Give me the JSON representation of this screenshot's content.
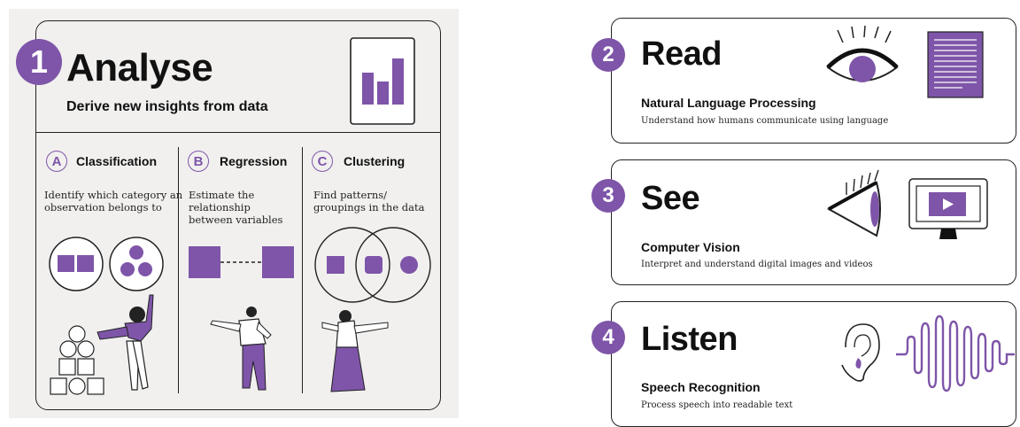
{
  "analyse": {
    "number": "1",
    "title": "Analyse",
    "subtitle": "Derive new insights from data",
    "columns": [
      {
        "letter": "A",
        "title": "Classification",
        "desc_lines": [
          "Identify which category an",
          "observation belongs to"
        ]
      },
      {
        "letter": "B",
        "title": "Regression",
        "desc_lines": [
          "Estimate the",
          "relationship",
          "between variables"
        ]
      },
      {
        "letter": "C",
        "title": "Clustering",
        "desc_lines": [
          "Find patterns/",
          "groupings in the data"
        ]
      }
    ]
  },
  "cards": [
    {
      "number": "2",
      "title": "Read",
      "subtitle": "Natural Language Processing",
      "desc": "Understand how humans communicate using language",
      "icons": [
        "eye-icon",
        "document-icon"
      ]
    },
    {
      "number": "3",
      "title": "See",
      "subtitle": "Computer Vision",
      "desc": "Interpret and understand digital images and videos",
      "icons": [
        "eye-side-icon",
        "monitor-play-icon"
      ]
    },
    {
      "number": "4",
      "title": "Listen",
      "subtitle": "Speech Recognition",
      "desc": "Process speech into readable text",
      "icons": [
        "ear-icon",
        "sound-wave-icon"
      ]
    }
  ],
  "colors": {
    "accent": "#7e55a8",
    "line": "#222222",
    "panel": "#f1f0ef"
  }
}
